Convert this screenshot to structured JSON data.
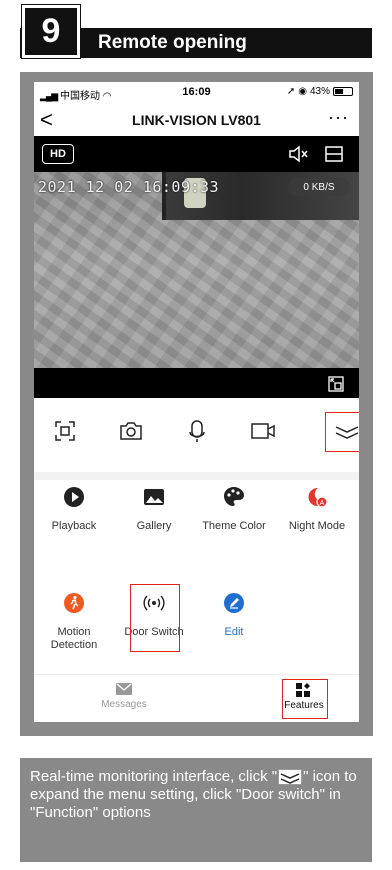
{
  "banner": {
    "step": "9",
    "title": "Remote opening"
  },
  "status": {
    "carrier": "中国移动",
    "time": "16:09",
    "battery": "43%"
  },
  "nav": {
    "back": "<",
    "title": "LINK-VISION LV801",
    "more": "···"
  },
  "video": {
    "hd_label": "HD",
    "timestamp": "2021 12 02 16:09:33",
    "rate": "0 KB/S"
  },
  "features": [
    {
      "label": "Playback"
    },
    {
      "label": "Gallery"
    },
    {
      "label": "Theme Color"
    },
    {
      "label": "Night Mode"
    },
    {
      "label": "Motion Detection"
    },
    {
      "label": "Door Switch"
    },
    {
      "label": "Edit"
    }
  ],
  "tabs": {
    "messages": "Messages",
    "features": "Features"
  },
  "caption": {
    "part1": "Real-time monitoring interface, click \"",
    "part2": "\" icon to expand the menu setting, click \"Door switch\" in \"Function\" options"
  },
  "colors": {
    "highlight": "#e2231a",
    "edit_blue": "#1f6fd1",
    "motion_orange": "#f05a22",
    "night_red": "#e8352a"
  }
}
